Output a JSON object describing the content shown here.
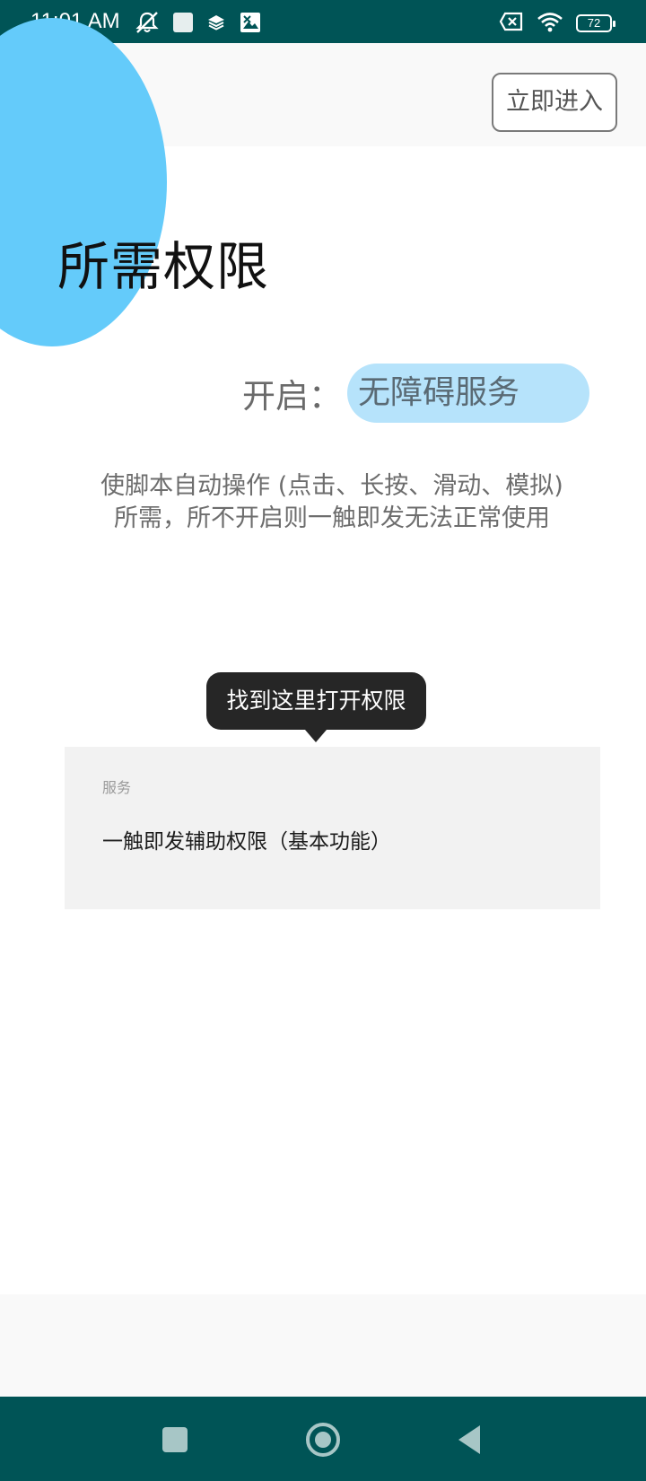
{
  "status_bar": {
    "time": "11:01 AM",
    "battery_level": "72",
    "icons_left": [
      "notifications-off-icon",
      "square-notification-icon",
      "layers-icon",
      "image-notification-icon"
    ],
    "icons_right": [
      "no-sim-icon",
      "wifi-icon",
      "battery-icon"
    ]
  },
  "header": {
    "enter_button_label": "立即进入"
  },
  "main": {
    "title": "所需权限",
    "enable_label": "开启：",
    "service_name": "无障碍服务",
    "description_line1": "使脚本自动操作 (点击、长按、滑动、模拟)",
    "description_line2": "所需，所不开启则一触即发无法正常使用"
  },
  "tooltip": {
    "text": "找到这里打开权限"
  },
  "settings_preview": {
    "section_label": "服务",
    "item_label": "一触即发辅助权限（基本功能）"
  },
  "navigation": {
    "buttons": [
      "recent-apps-icon",
      "home-icon",
      "back-icon"
    ]
  },
  "colors": {
    "status_bar": "#005456",
    "accent_circle": "#64cbfa",
    "service_pill": "#b6e3fb",
    "tooltip_bg": "#262626"
  }
}
